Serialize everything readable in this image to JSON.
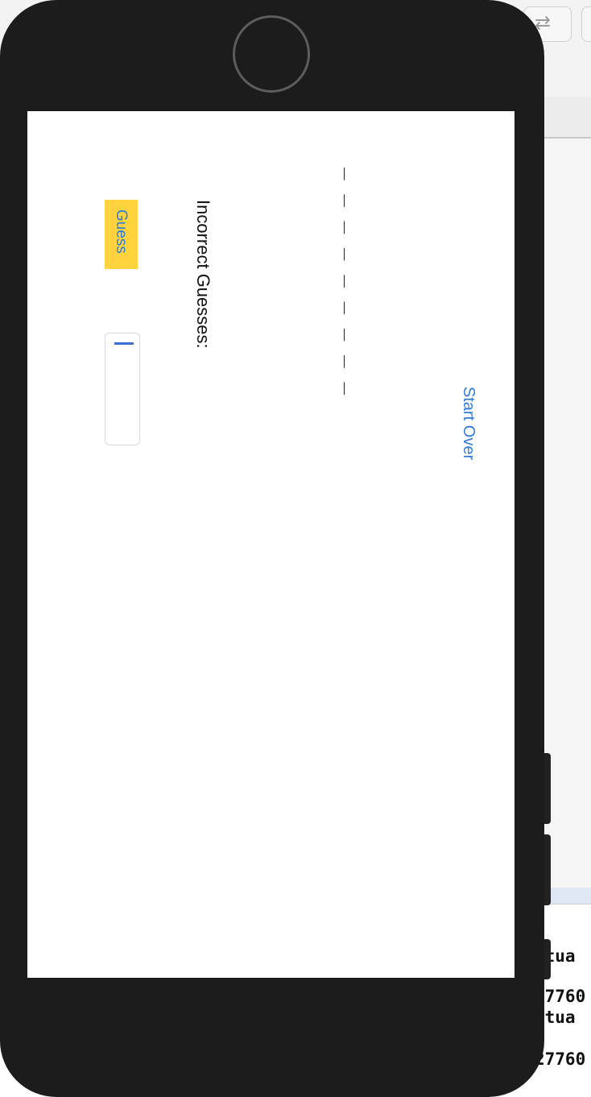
{
  "toolbar": {
    "arrow_icon": "arrow-right-icon"
  },
  "console": {
    "lines": [
      "ctua",
      "27760",
      "ctua",
      "27760"
    ]
  },
  "screen": {
    "word_blanks": "_ _ _ _ _ _ _ _ _",
    "start_over_label": "Start Over",
    "incorrect_label": "Incorrect Guesses:",
    "guess_button_label": "Guess",
    "guess_input_value": ""
  },
  "colors": {
    "accent": "#2f7bd6",
    "button_bg": "#ffd33d",
    "phone_frame": "#1c1c1c"
  }
}
